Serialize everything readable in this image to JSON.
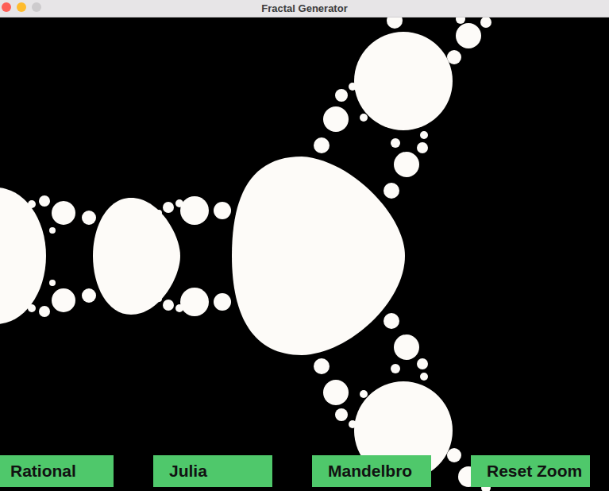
{
  "window": {
    "title": "Fractal Generator"
  },
  "buttons": [
    {
      "label": "Rational"
    },
    {
      "label": "Julia"
    },
    {
      "label": "Mandelbro"
    },
    {
      "label": "Reset Zoom"
    }
  ]
}
